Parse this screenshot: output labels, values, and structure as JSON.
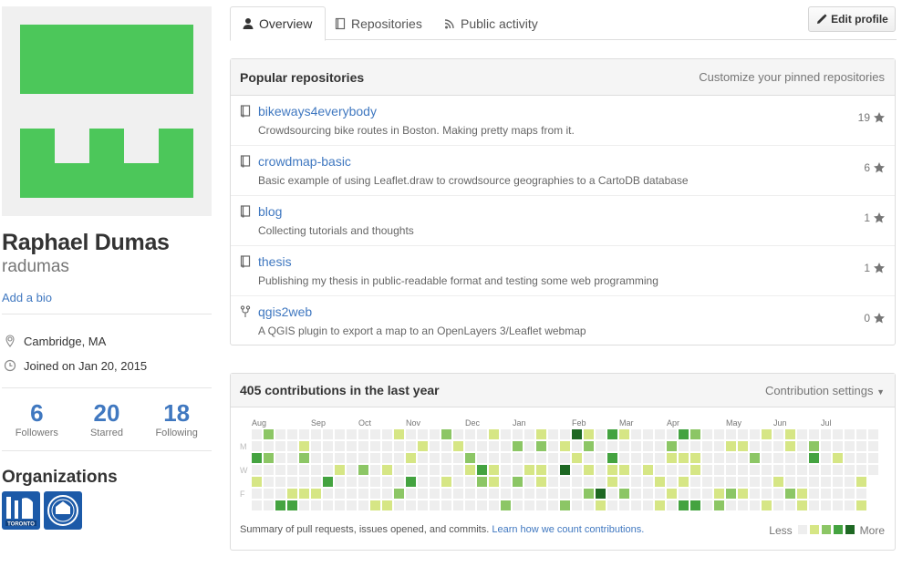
{
  "profile": {
    "fullname": "Raphael Dumas",
    "username": "radumas",
    "bio_link": "Add a bio",
    "location": "Cambridge, MA",
    "joined": "Joined on Jan 20, 2015",
    "avatar_color": "#4cc75a",
    "stats": [
      {
        "num": "6",
        "label": "Followers"
      },
      {
        "num": "20",
        "label": "Starred"
      },
      {
        "num": "18",
        "label": "Following"
      }
    ],
    "organizations_title": "Organizations",
    "organizations": [
      {
        "name": "toronto-org",
        "text": "TORONTO"
      },
      {
        "name": "circle-org"
      }
    ]
  },
  "tabs": [
    {
      "label": "Overview",
      "icon": "person-icon",
      "active": true
    },
    {
      "label": "Repositories",
      "icon": "repo-book-icon",
      "active": false
    },
    {
      "label": "Public activity",
      "icon": "rss-icon",
      "active": false
    }
  ],
  "edit_profile": "Edit profile",
  "popular": {
    "title": "Popular repositories",
    "action": "Customize your pinned repositories",
    "repos": [
      {
        "name": "bikeways4everybody",
        "desc": "Crowdsourcing bike routes in Boston. Making pretty maps from it.",
        "stars": "19",
        "icon": "repo"
      },
      {
        "name": "crowdmap-basic",
        "desc": "Basic example of using Leaflet.draw to crowdsource geographies to a CartoDB database",
        "stars": "6",
        "icon": "repo"
      },
      {
        "name": "blog",
        "desc": "Collecting tutorials and thoughts",
        "stars": "1",
        "icon": "repo"
      },
      {
        "name": "thesis",
        "desc": "Publishing my thesis in public-readable format and testing some web programming",
        "stars": "1",
        "icon": "repo"
      },
      {
        "name": "qgis2web",
        "desc": "A QGIS plugin to export a map to an OpenLayers 3/Leaflet webmap",
        "stars": "0",
        "icon": "fork"
      }
    ]
  },
  "contributions": {
    "title": "405 contributions in the last year",
    "settings": "Contribution settings",
    "months": [
      "Aug",
      "Sep",
      "Oct",
      "Nov",
      "Dec",
      "Jan",
      "Feb",
      "Mar",
      "Apr",
      "May",
      "Jun",
      "Jul"
    ],
    "month_week_index": [
      0,
      5,
      9,
      13,
      18,
      22,
      27,
      31,
      35,
      40,
      44,
      48
    ],
    "day_labels": [
      "",
      "M",
      "",
      "W",
      "",
      "F",
      ""
    ],
    "summary": "Summary of pull requests, issues opened, and commits.",
    "learn_link": "Learn how we count contributions.",
    "legend_less": "Less",
    "legend_more": "More",
    "colors": [
      "#eeeeee",
      "#d6e685",
      "#8cc665",
      "#44a340",
      "#1e6823"
    ]
  }
}
